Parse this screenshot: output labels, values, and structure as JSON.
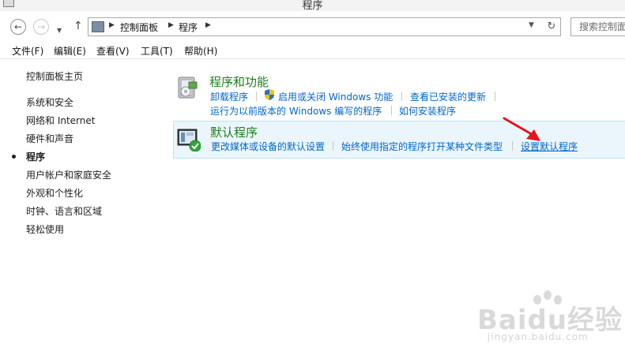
{
  "window": {
    "title": "程序"
  },
  "nav": {
    "back_glyph": "←",
    "forward_glyph": "→",
    "up_glyph": "↑",
    "refresh_glyph": "↻",
    "breadcrumbs": [
      "控制面板",
      "程序"
    ],
    "search_placeholder": "搜索控制面板"
  },
  "menu": {
    "items": [
      "文件(F)",
      "编辑(E)",
      "查看(V)",
      "工具(T)",
      "帮助(H)"
    ]
  },
  "sidebar": {
    "home": "控制面板主页",
    "items": [
      "系统和安全",
      "网络和 Internet",
      "硬件和声音",
      "程序",
      "用户帐户和家庭安全",
      "外观和个性化",
      "时钟、语言和区域",
      "轻松使用"
    ],
    "current_index": 3
  },
  "sections": [
    {
      "title": "程序和功能",
      "icon": "programs-features-icon",
      "links_row1": [
        "卸载程序",
        "启用或关闭 Windows 功能",
        "查看已安装的更新"
      ],
      "links_row2": [
        "运行为以前版本的 Windows 编写的程序",
        "如何安装程序"
      ]
    },
    {
      "title": "默认程序",
      "icon": "default-programs-icon",
      "links": [
        "更改媒体或设备的默认设置",
        "始终使用指定的程序打开某种文件类型",
        "设置默认程序"
      ]
    }
  ],
  "watermark": {
    "brand": "Baidu经验",
    "sub": "jingyan.baidu.com"
  },
  "colors": {
    "section_title": "#1e7d1e",
    "link": "#0066cc",
    "highlight_bg": "#eaf6fc",
    "arrow": "#e8121b"
  }
}
